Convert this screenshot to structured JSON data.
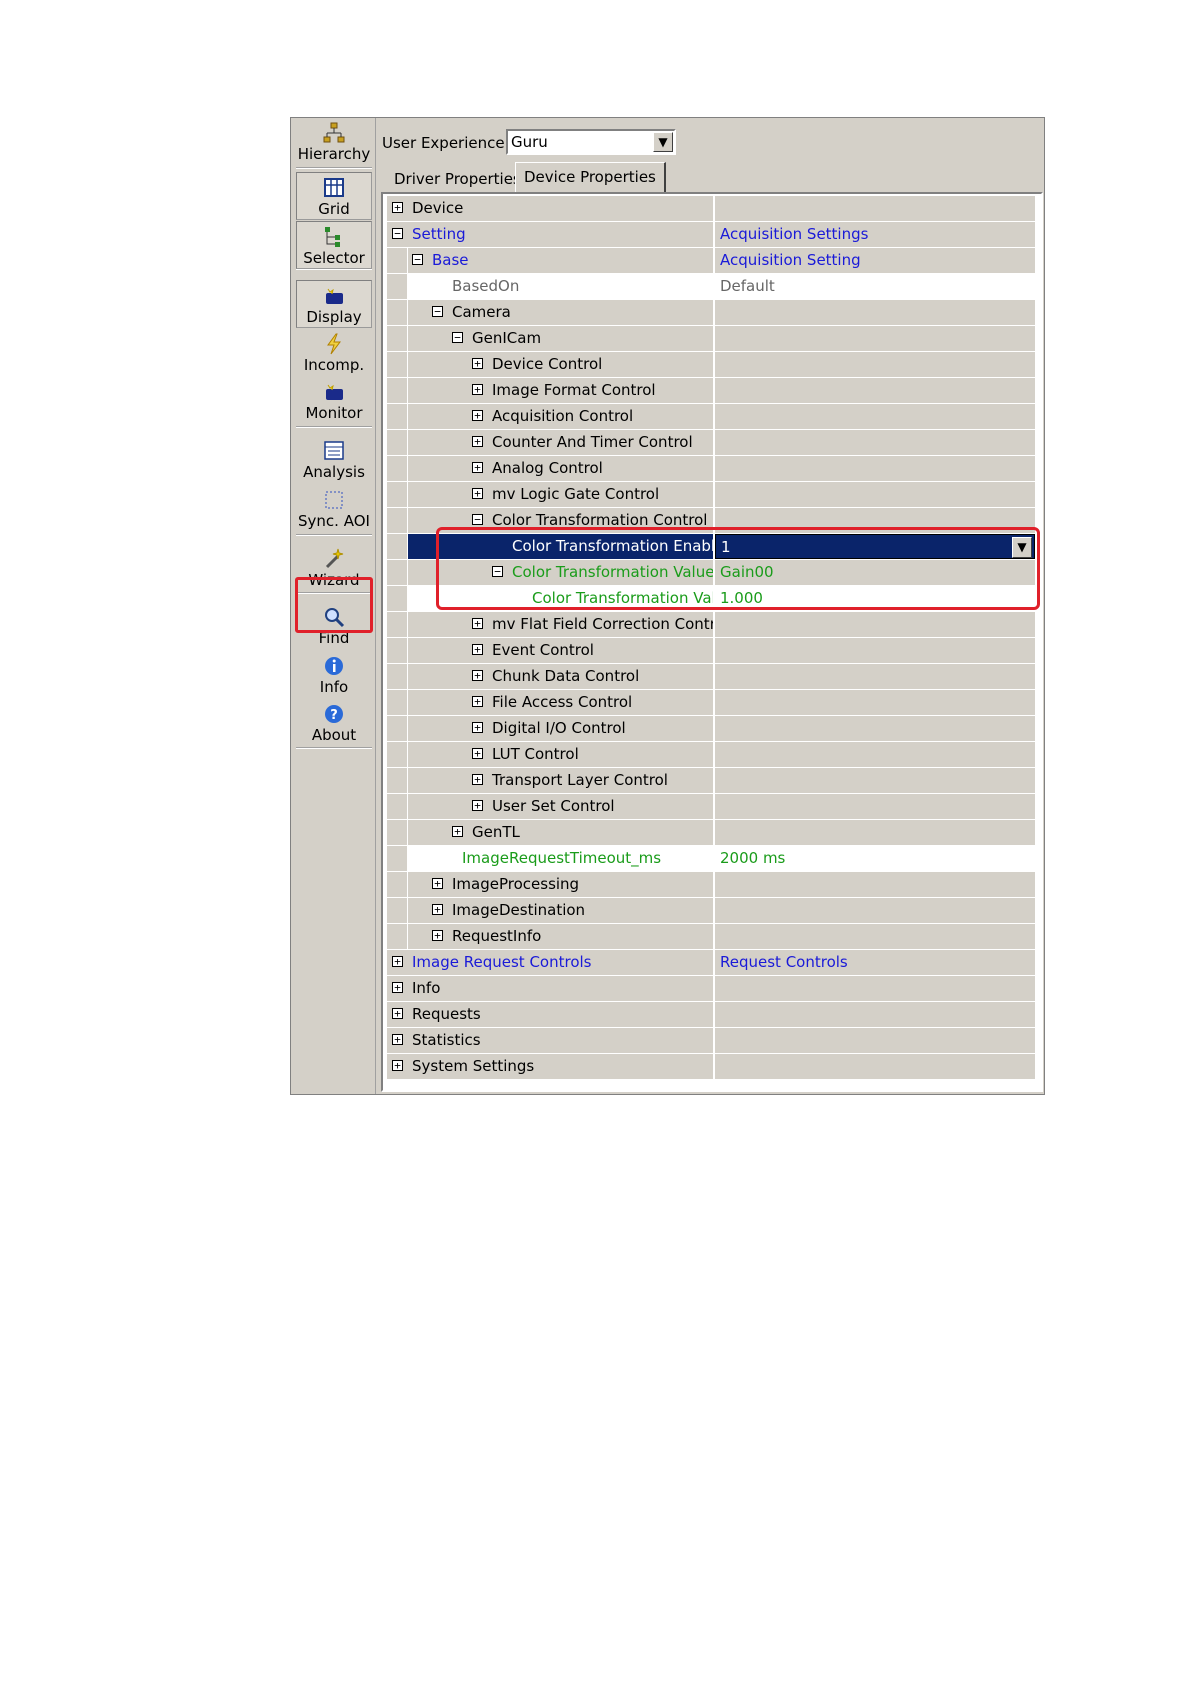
{
  "toolbar": {
    "buttons": [
      {
        "label": "Hierarchy",
        "icon": "hierarchy-icon"
      },
      {
        "label": "Grid",
        "icon": "grid-icon"
      },
      {
        "label": "Selector",
        "icon": "selector-icon"
      },
      {
        "label": "Display",
        "icon": "display-icon"
      },
      {
        "label": "Incomp.",
        "icon": "incomp-icon"
      },
      {
        "label": "Monitor",
        "icon": "monitor-icon"
      },
      {
        "label": "Analysis",
        "icon": "analysis-icon"
      },
      {
        "label": "Sync. AOI",
        "icon": "sync-aoi-icon"
      },
      {
        "label": "Wizard",
        "icon": "wizard-icon"
      },
      {
        "label": "Find",
        "icon": "find-icon"
      },
      {
        "label": "Info",
        "icon": "info-icon"
      },
      {
        "label": "About",
        "icon": "about-icon"
      }
    ]
  },
  "user_experience": {
    "label": "User Experience:",
    "value": "Guru"
  },
  "tabs": {
    "driver": "Driver Properties",
    "device": "Device Properties"
  },
  "colors": {
    "highlight": "#e0202a",
    "link": "#1a1ad8",
    "modified": "#1a9c1a",
    "selection": "#0a246a"
  },
  "rows": [
    {
      "name": "Device",
      "value": "",
      "level": 0,
      "exp": "+",
      "style": ""
    },
    {
      "name": "Setting",
      "value": "Acquisition Settings",
      "level": 0,
      "exp": "-",
      "style": "blue"
    },
    {
      "name": "Base",
      "value": "Acquisition Setting",
      "level": 1,
      "exp": "-",
      "style": "blue"
    },
    {
      "name": "BasedOn",
      "value": "Default",
      "level": 3,
      "exp": "",
      "style": "gray",
      "white": true
    },
    {
      "name": "Camera",
      "value": "",
      "level": 2,
      "exp": "-",
      "style": ""
    },
    {
      "name": "GenICam",
      "value": "",
      "level": 3,
      "exp": "-",
      "style": ""
    },
    {
      "name": "Device Control",
      "value": "",
      "level": 4,
      "exp": "+",
      "style": ""
    },
    {
      "name": "Image Format Control",
      "value": "",
      "level": 4,
      "exp": "+",
      "style": ""
    },
    {
      "name": "Acquisition Control",
      "value": "",
      "level": 4,
      "exp": "+",
      "style": ""
    },
    {
      "name": "Counter And Timer Control",
      "value": "",
      "level": 4,
      "exp": "+",
      "style": ""
    },
    {
      "name": "Analog Control",
      "value": "",
      "level": 4,
      "exp": "+",
      "style": ""
    },
    {
      "name": "mv Logic Gate Control",
      "value": "",
      "level": 4,
      "exp": "+",
      "style": ""
    },
    {
      "name": "Color Transformation Control",
      "value": "",
      "level": 4,
      "exp": "-",
      "style": ""
    },
    {
      "name": "Color Transformation Enable",
      "value": "1",
      "level": 6,
      "exp": "",
      "style": "",
      "selected": true
    },
    {
      "name": "Color Transformation Value",
      "value": "Gain00",
      "level": 5,
      "exp": "-",
      "style": "green"
    },
    {
      "name": "Color Transformation Value",
      "value": "1.000",
      "level": 7,
      "exp": "",
      "style": "green",
      "white": true
    },
    {
      "name": "mv Flat Field Correction Control",
      "value": "",
      "level": 4,
      "exp": "+",
      "style": ""
    },
    {
      "name": "Event Control",
      "value": "",
      "level": 4,
      "exp": "+",
      "style": ""
    },
    {
      "name": "Chunk Data Control",
      "value": "",
      "level": 4,
      "exp": "+",
      "style": ""
    },
    {
      "name": "File Access Control",
      "value": "",
      "level": 4,
      "exp": "+",
      "style": ""
    },
    {
      "name": "Digital I/O Control",
      "value": "",
      "level": 4,
      "exp": "+",
      "style": ""
    },
    {
      "name": "LUT Control",
      "value": "",
      "level": 4,
      "exp": "+",
      "style": ""
    },
    {
      "name": "Transport Layer Control",
      "value": "",
      "level": 4,
      "exp": "+",
      "style": ""
    },
    {
      "name": "User Set Control",
      "value": "",
      "level": 4,
      "exp": "+",
      "style": ""
    },
    {
      "name": "GenTL",
      "value": "",
      "level": 3,
      "exp": "+",
      "style": ""
    },
    {
      "name": "ImageRequestTimeout_ms",
      "value": "2000 ms",
      "level": 3.5,
      "exp": "",
      "style": "green",
      "white": true
    },
    {
      "name": "ImageProcessing",
      "value": "",
      "level": 2,
      "exp": "+",
      "style": ""
    },
    {
      "name": "ImageDestination",
      "value": "",
      "level": 2,
      "exp": "+",
      "style": ""
    },
    {
      "name": "RequestInfo",
      "value": "",
      "level": 2,
      "exp": "+",
      "style": ""
    },
    {
      "name": "Image Request Controls",
      "value": "Request Controls",
      "level": 0,
      "exp": "+",
      "style": "blue"
    },
    {
      "name": "Info",
      "value": "",
      "level": 0,
      "exp": "+",
      "style": ""
    },
    {
      "name": "Requests",
      "value": "",
      "level": 0,
      "exp": "+",
      "style": ""
    },
    {
      "name": "Statistics",
      "value": "",
      "level": 0,
      "exp": "+",
      "style": ""
    },
    {
      "name": "System Settings",
      "value": "",
      "level": 0,
      "exp": "+",
      "style": ""
    }
  ]
}
